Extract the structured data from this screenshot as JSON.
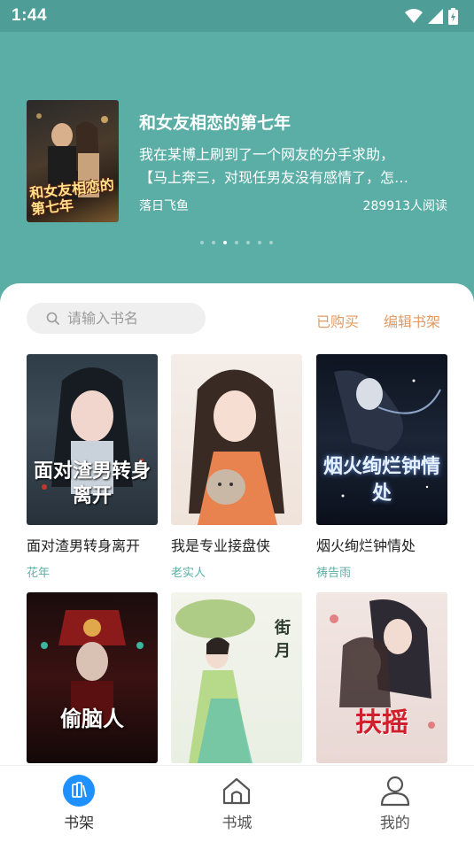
{
  "status": {
    "time": "1:44"
  },
  "banner": {
    "title": "和女友相恋的第七年",
    "cover_text": "和女友相恋的第七年",
    "desc_line1": "我在某博上刷到了一个网友的分手求助，",
    "desc_line2": "【马上奔三，对现任男友没有感情了，怎…",
    "author": "落日飞鱼",
    "reads": "289913人阅读",
    "active_dot": 2,
    "dot_count": 7
  },
  "toolbar": {
    "search_placeholder": "请输入书名",
    "purchased_label": "已购买",
    "edit_label": "编辑书架"
  },
  "books": [
    {
      "name": "面对渣男转身离开",
      "author": "花年",
      "cover_text": "面对渣男转身离开"
    },
    {
      "name": "我是专业接盘侠",
      "author": "老实人",
      "cover_text": ""
    },
    {
      "name": "烟火绚烂钟情处",
      "author": "祷告雨",
      "cover_text": "烟火绚烂钟情处"
    },
    {
      "name": "",
      "author": "",
      "cover_text": "偷脑人"
    },
    {
      "name": "",
      "author": "",
      "cover_text": "街月"
    },
    {
      "name": "",
      "author": "",
      "cover_text": "扶摇"
    }
  ],
  "nav": {
    "shelf": "书架",
    "store": "书城",
    "mine": "我的"
  },
  "colors": {
    "accent": "#5BAEA6",
    "action": "#E39A63",
    "nav_active": "#1E90FF"
  }
}
